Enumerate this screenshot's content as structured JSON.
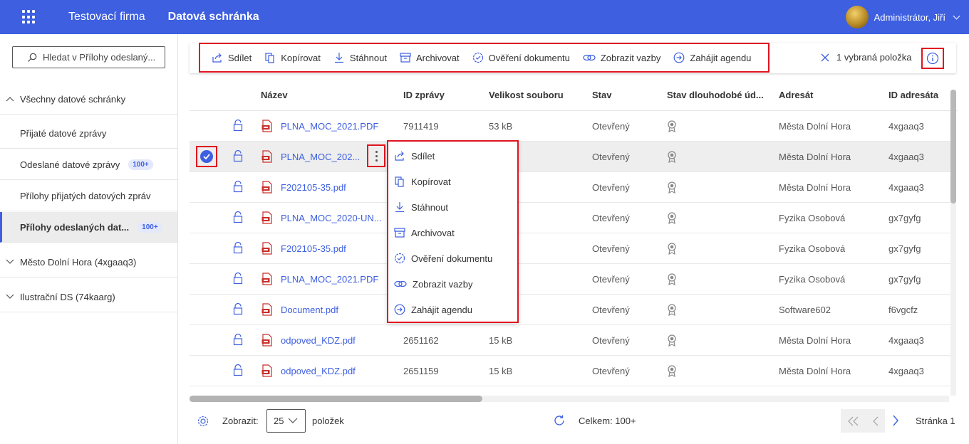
{
  "header": {
    "company": "Testovací firma",
    "app_title": "Datová schránka",
    "user_name": "Administrátor, Jiří"
  },
  "sidebar": {
    "search_placeholder": "Hledat v Přílohy odeslaný...",
    "groups": [
      {
        "label": "Všechny datové schránky",
        "expanded": true
      },
      {
        "label": "Město Dolní Hora (4xgaaq3)",
        "expanded": false
      },
      {
        "label": "Ilustrační DS (74kaarg)",
        "expanded": false
      }
    ],
    "items": [
      {
        "label": "Přijaté datové zprávy",
        "badge": ""
      },
      {
        "label": "Odeslané datové zprávy",
        "badge": "100+"
      },
      {
        "label": "Přílohy přijatých datových zpráv",
        "badge": ""
      },
      {
        "label": "Přílohy odeslaných dat...",
        "badge": "100+",
        "active": true
      }
    ]
  },
  "toolbar": {
    "actions": [
      "Sdílet",
      "Kopírovat",
      "Stáhnout",
      "Archivovat",
      "Ověření dokumentu",
      "Zobrazit vazby",
      "Zahájit agendu"
    ],
    "selection_text": "1 vybraná položka"
  },
  "table": {
    "headers": [
      "Název",
      "ID zprávy",
      "Velikost souboru",
      "Stav",
      "Stav dlouhodobé úd...",
      "Adresát",
      "ID adresáta"
    ],
    "rows": [
      {
        "name": "PLNA_MOC_2021.PDF",
        "id": "7911419",
        "size": "53 kB",
        "state": "Otevřený",
        "recipient": "Města Dolní Hora",
        "recipient_id": "4xgaaq3",
        "selected": false
      },
      {
        "name": "PLNA_MOC_202...",
        "id": "",
        "size": "",
        "state": "Otevřený",
        "recipient": "Města Dolní Hora",
        "recipient_id": "4xgaaq3",
        "selected": true
      },
      {
        "name": "F202105-35.pdf",
        "id": "",
        "size": "",
        "state": "Otevřený",
        "recipient": "Města Dolní Hora",
        "recipient_id": "4xgaaq3",
        "selected": false
      },
      {
        "name": "PLNA_MOC_2020-UN...",
        "id": "",
        "size": "",
        "state": "Otevřený",
        "recipient": "Fyzika Osobová",
        "recipient_id": "gx7gyfg",
        "selected": false
      },
      {
        "name": "F202105-35.pdf",
        "id": "",
        "size": "",
        "state": "Otevřený",
        "recipient": "Fyzika Osobová",
        "recipient_id": "gx7gyfg",
        "selected": false
      },
      {
        "name": "PLNA_MOC_2021.PDF",
        "id": "",
        "size": "",
        "state": "Otevřený",
        "recipient": "Fyzika Osobová",
        "recipient_id": "gx7gyfg",
        "selected": false
      },
      {
        "name": "Document.pdf",
        "id": "",
        "size": "",
        "state": "Otevřený",
        "recipient": "Software602",
        "recipient_id": "f6vgcfz",
        "selected": false
      },
      {
        "name": "odpoved_KDZ.pdf",
        "id": "2651162",
        "size": "15 kB",
        "state": "Otevřený",
        "recipient": "Města Dolní Hora",
        "recipient_id": "4xgaaq3",
        "selected": false
      },
      {
        "name": "odpoved_KDZ.pdf",
        "id": "2651159",
        "size": "15 kB",
        "state": "Otevřený",
        "recipient": "Města Dolní Hora",
        "recipient_id": "4xgaaq3",
        "selected": false
      }
    ]
  },
  "context_menu": {
    "items": [
      "Sdílet",
      "Kopírovat",
      "Stáhnout",
      "Archivovat",
      "Ověření dokumentu",
      "Zobrazit vazby",
      "Zahájit agendu"
    ]
  },
  "footer": {
    "show_label": "Zobrazit:",
    "page_size": "25",
    "items_label": "položek",
    "total": "Celkem: 100+",
    "page_label": "Stránka 1"
  },
  "colors": {
    "brand": "#3d5fe0",
    "highlight": "#e0141e",
    "pdf": "#c9302c"
  }
}
